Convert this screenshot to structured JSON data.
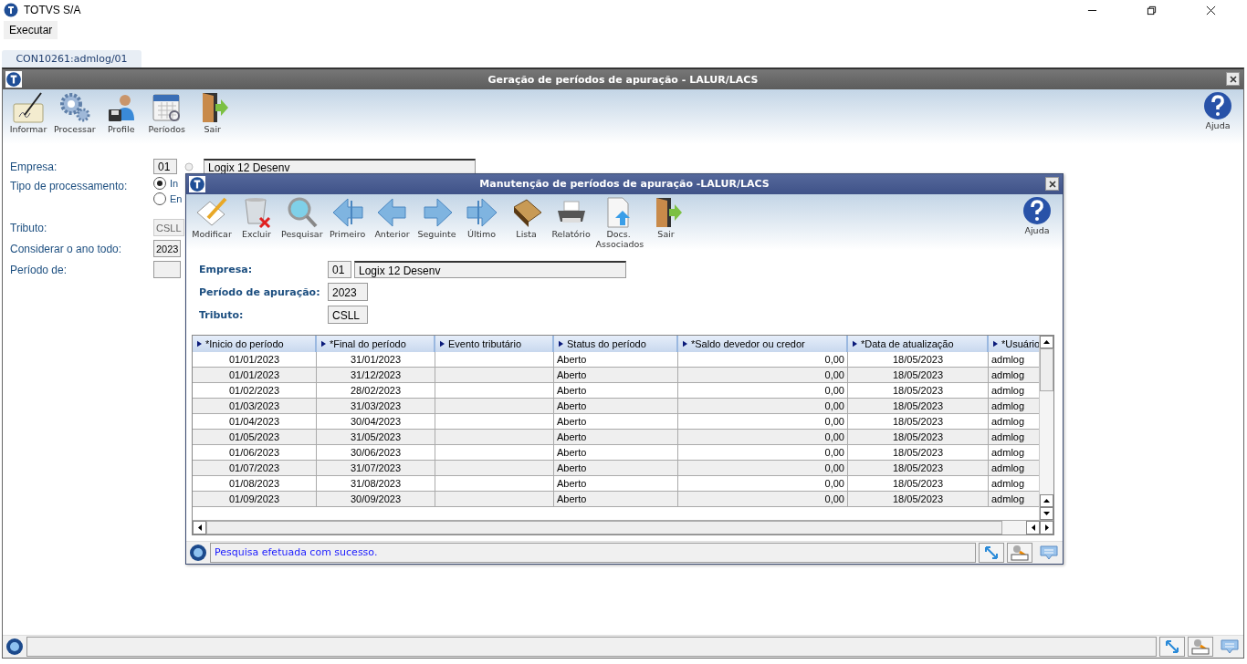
{
  "window": {
    "title": "TOTVS S/A"
  },
  "menu": [
    {
      "label": "Executar"
    }
  ],
  "tabs": [
    {
      "label": "CON10261:admlog/01",
      "selected": true
    }
  ],
  "main": {
    "title": "Geração de períodos de apuração - LALUR/LACS",
    "toolbar": [
      {
        "label": "Informar",
        "kind": "sign"
      },
      {
        "label": "Processar",
        "kind": "gears"
      },
      {
        "label": "Profile",
        "kind": "user"
      },
      {
        "label": "Períodos",
        "kind": "calendar"
      },
      {
        "label": "Sair",
        "kind": "exit"
      }
    ],
    "help": "Ajuda",
    "fields": [
      {
        "label": "Empresa:",
        "kind": "code_name",
        "code": "01",
        "name": "Logix 12 Desenv"
      },
      {
        "label": "Tipo de processamento:",
        "kind": "radio",
        "options": [
          {
            "label": "In",
            "selected": true
          },
          {
            "label": "En",
            "selected": false
          }
        ]
      },
      {
        "label": "Tributo:",
        "kind": "text",
        "value": "CSLL",
        "disabled": true
      },
      {
        "label": "Considerar o ano todo:",
        "kind": "text",
        "value": "2023",
        "disabled": false
      },
      {
        "label": "Período de:",
        "kind": "text",
        "disabled": false
      }
    ]
  },
  "dialog": {
    "title": "Manutenção de períodos de apuração -LALUR/LACS",
    "toolbar": [
      {
        "label": "Modificar",
        "kind": "edit"
      },
      {
        "label": "Excluir",
        "kind": "trash"
      },
      {
        "label": "Pesquisar",
        "kind": "search"
      },
      {
        "label": "Primeiro",
        "kind": "first"
      },
      {
        "label": "Anterior",
        "kind": "prev"
      },
      {
        "label": "Seguinte",
        "kind": "next"
      },
      {
        "label": "Último",
        "kind": "last"
      },
      {
        "label": "Lista",
        "kind": "book"
      },
      {
        "label": "Relatório",
        "kind": "printer"
      },
      {
        "label": "Docs. Associados",
        "kind": "docs"
      },
      {
        "label": "Sair",
        "kind": "exit"
      }
    ],
    "help": "Ajuda",
    "fields": [
      {
        "label": "Empresa:",
        "kind": "code_name",
        "code": "01",
        "name": "Logix 12 Desenv"
      },
      {
        "label": "Período de apuração:",
        "kind": "text",
        "value": "2023"
      },
      {
        "label": "Tributo:",
        "kind": "text",
        "value": "CSLL"
      }
    ],
    "table": {
      "columns": [
        "*Inicio do período",
        "*Final do período",
        "Evento tributário",
        "Status do período",
        "*Saldo devedor ou credor",
        "*Data de atualização",
        "*Usuário"
      ],
      "rows": [
        {
          "start": "01/01/2023",
          "end": "31/01/2023",
          "status": "Aberto",
          "balance": "0,00",
          "updated": "18/05/2023",
          "user": "admlog"
        },
        {
          "start": "01/01/2023",
          "end": "31/12/2023",
          "status": "Aberto",
          "balance": "0,00",
          "updated": "18/05/2023",
          "user": "admlog"
        },
        {
          "start": "01/02/2023",
          "end": "28/02/2023",
          "status": "Aberto",
          "balance": "0,00",
          "updated": "18/05/2023",
          "user": "admlog"
        },
        {
          "start": "01/03/2023",
          "end": "31/03/2023",
          "status": "Aberto",
          "balance": "0,00",
          "updated": "18/05/2023",
          "user": "admlog"
        },
        {
          "start": "01/04/2023",
          "end": "30/04/2023",
          "status": "Aberto",
          "balance": "0,00",
          "updated": "18/05/2023",
          "user": "admlog"
        },
        {
          "start": "01/05/2023",
          "end": "31/05/2023",
          "status": "Aberto",
          "balance": "0,00",
          "updated": "18/05/2023",
          "user": "admlog"
        },
        {
          "start": "01/06/2023",
          "end": "30/06/2023",
          "status": "Aberto",
          "balance": "0,00",
          "updated": "18/05/2023",
          "user": "admlog"
        },
        {
          "start": "01/07/2023",
          "end": "31/07/2023",
          "status": "Aberto",
          "balance": "0,00",
          "updated": "18/05/2023",
          "user": "admlog"
        },
        {
          "start": "01/08/2023",
          "end": "31/08/2023",
          "status": "Aberto",
          "balance": "0,00",
          "updated": "18/05/2023",
          "user": "admlog"
        },
        {
          "start": "01/09/2023",
          "end": "30/09/2023",
          "status": "Aberto",
          "balance": "0,00",
          "updated": "18/05/2023",
          "user": "admlog"
        }
      ]
    },
    "status": "Pesquisa efetuada com sucesso."
  }
}
